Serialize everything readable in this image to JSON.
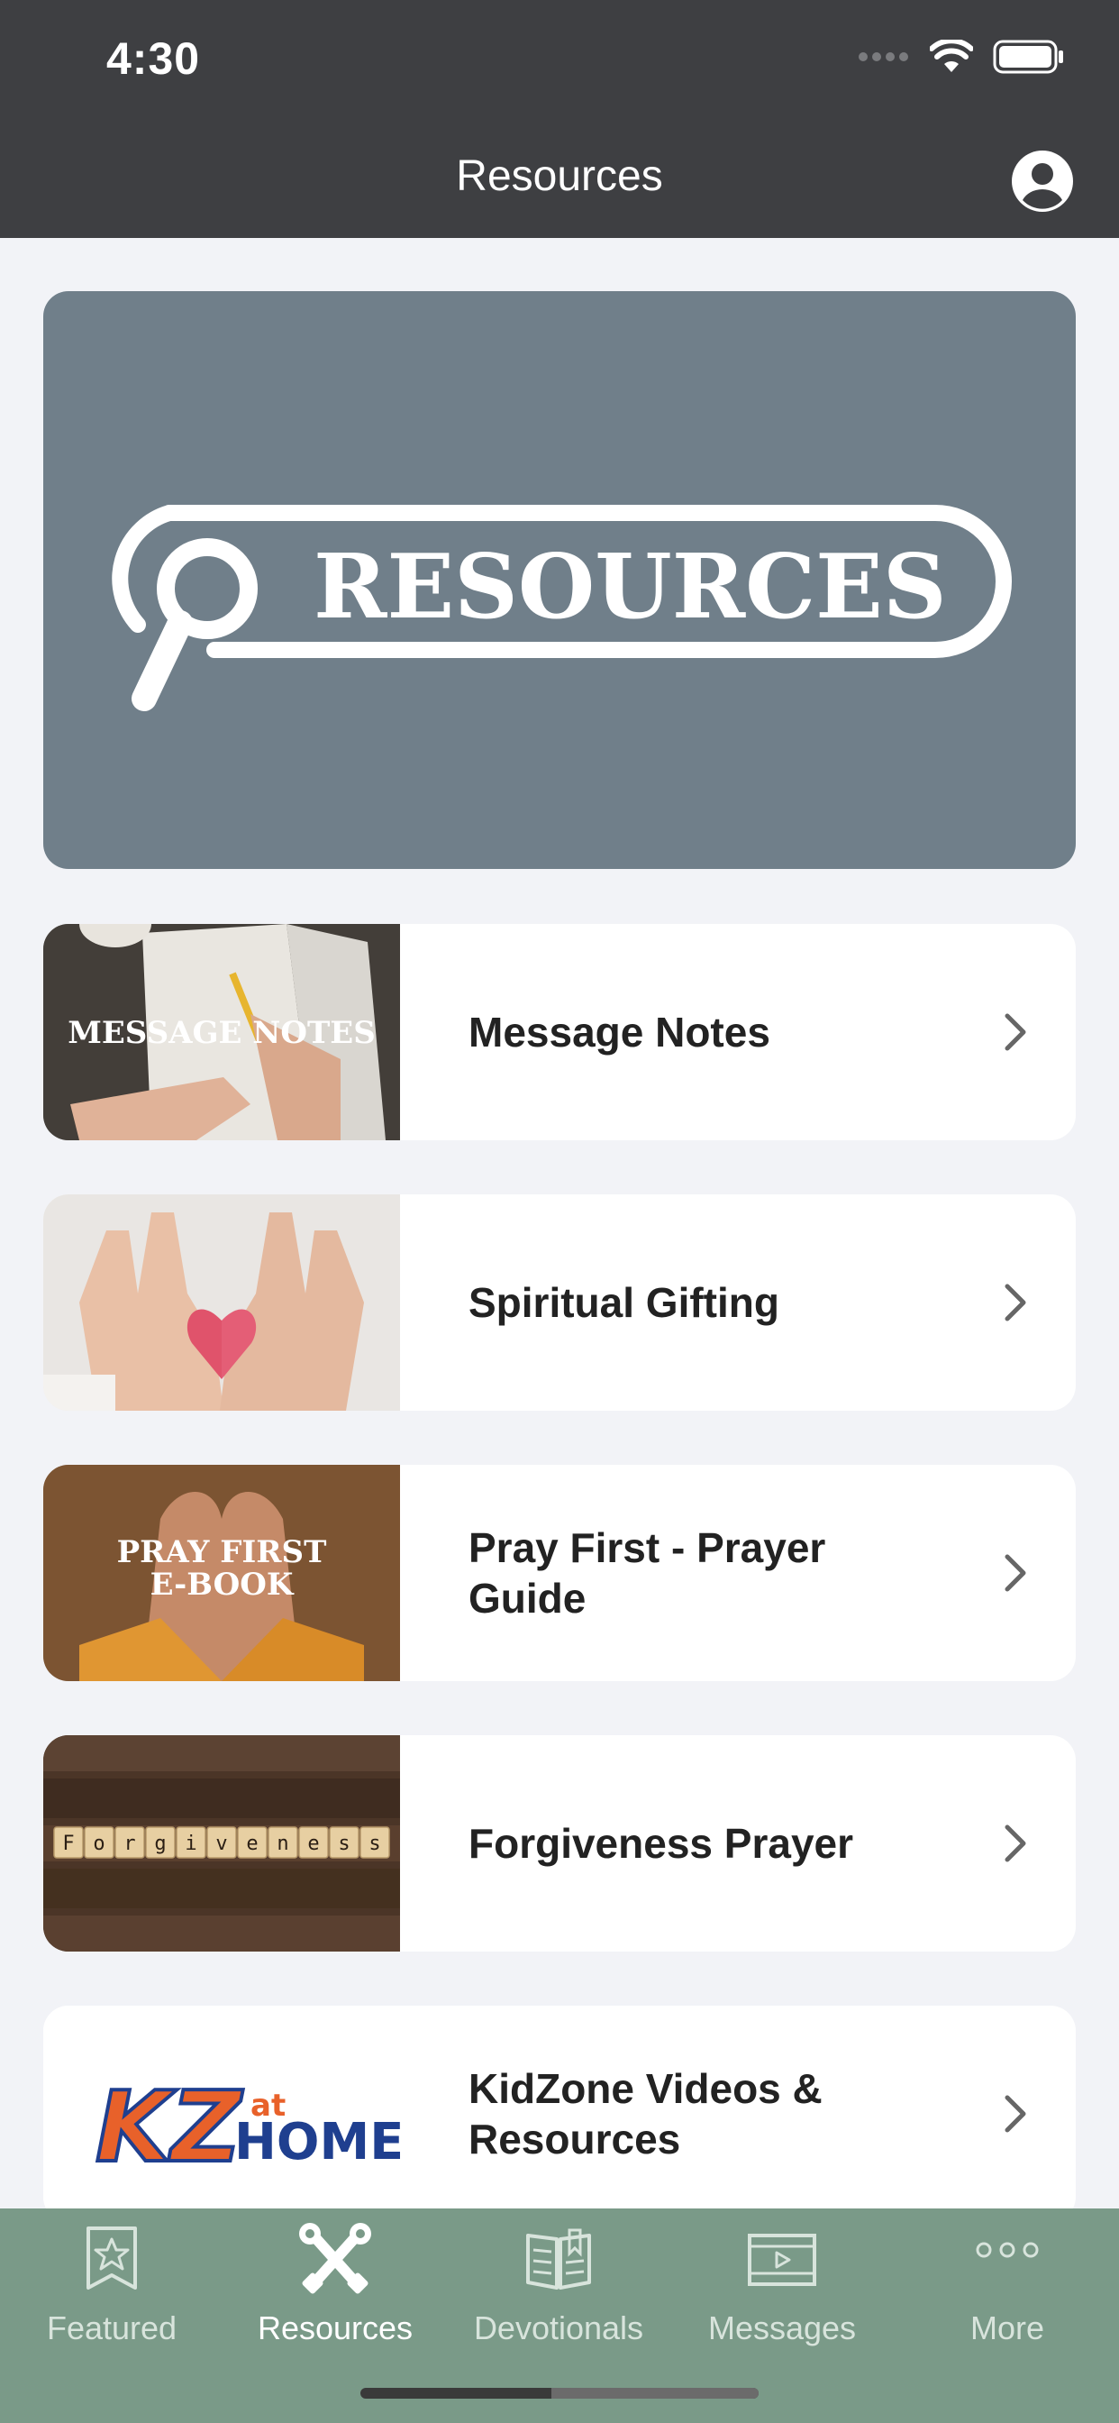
{
  "status_bar": {
    "time": "4:30"
  },
  "header": {
    "title": "Resources"
  },
  "hero": {
    "text": "RESOURCES"
  },
  "resources": [
    {
      "label": "Message Notes",
      "thumb_text": "MESSAGE NOTES"
    },
    {
      "label": "Spiritual Gifting"
    },
    {
      "label": "Pray First - Prayer Guide",
      "thumb_text_1": "PRAY FIRST",
      "thumb_text_2": "E-BOOK"
    },
    {
      "label": "Forgiveness Prayer",
      "thumb_letters": "Forgiveness"
    },
    {
      "label": "KidZone Videos & Resources",
      "logo_kz": "KZ",
      "logo_at": "at",
      "logo_home": "HOME"
    }
  ],
  "tabs": [
    {
      "label": "Featured",
      "icon": "star-badge-icon",
      "active": false
    },
    {
      "label": "Resources",
      "icon": "tools-icon",
      "active": true
    },
    {
      "label": "Devotionals",
      "icon": "book-icon",
      "active": false
    },
    {
      "label": "Messages",
      "icon": "video-icon",
      "active": false
    },
    {
      "label": "More",
      "icon": "more-dots-icon",
      "active": false
    }
  ],
  "colors": {
    "header_bg": "#3e3f42",
    "hero_bg": "#707f8a",
    "tabbar_bg": "#7a9a88",
    "page_bg": "#f2f3f7"
  }
}
